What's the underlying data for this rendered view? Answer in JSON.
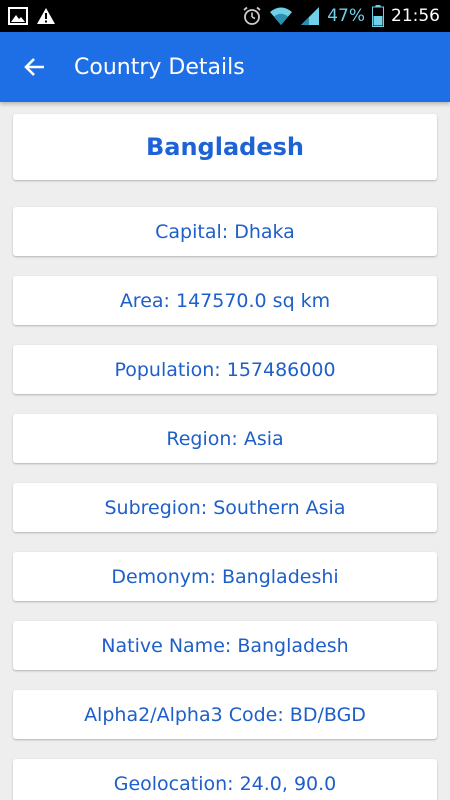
{
  "status_bar": {
    "battery_percent": "47%",
    "time": "21:56",
    "icons": [
      "image-icon",
      "warning-icon",
      "alarm-icon",
      "wifi-icon",
      "signal-icon",
      "battery-icon"
    ]
  },
  "app_bar": {
    "title": "Country Details",
    "back_icon": "arrow-left-icon",
    "background_color": "#1e6fe6"
  },
  "country": {
    "name": "Bangladesh",
    "details": [
      "Capital: Dhaka",
      "Area: 147570.0 sq km",
      "Population: 157486000",
      "Region: Asia",
      "Subregion: Southern Asia",
      "Demonym: Bangladeshi",
      "Native Name: Bangladesh",
      "Alpha2/Alpha3 Code: BD/BGD",
      "Geolocation: 24.0, 90.0"
    ]
  },
  "colors": {
    "text_blue": "#1e5fc9",
    "background": "#eeeeee"
  }
}
